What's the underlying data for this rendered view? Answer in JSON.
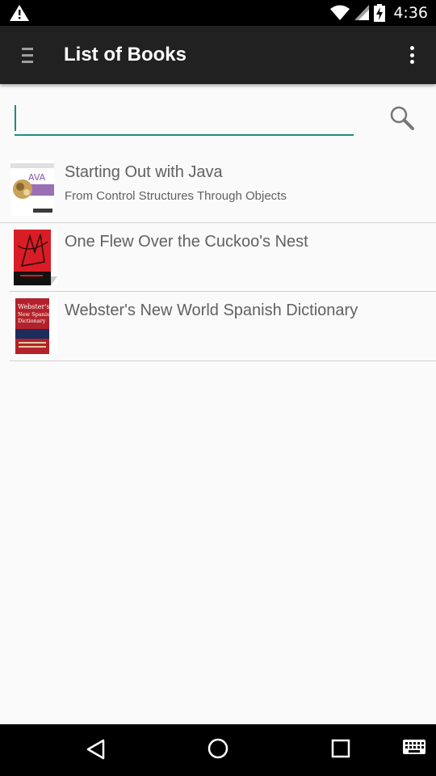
{
  "status_bar": {
    "time": "4:36",
    "icons": [
      "warning-icon",
      "wifi-icon",
      "signal-icon",
      "battery-charging-icon"
    ]
  },
  "app_bar": {
    "title": "List of Books",
    "menu_icon": "hamburger-icon",
    "overflow_icon": "more-vert-icon"
  },
  "search": {
    "value": "",
    "placeholder": "",
    "icon": "search-icon",
    "accent_color": "#1e8c82"
  },
  "books": [
    {
      "title": "Starting Out with Java",
      "subtitle": "From Control Structures Through Objects",
      "cover_text": "JAVA"
    },
    {
      "title": "One Flew Over the Cuckoo's Nest",
      "subtitle": "",
      "cover_text": ""
    },
    {
      "title": "Webster's New World Spanish Dictionary",
      "subtitle": "",
      "cover_text": "Webster's New Spanish Dictionary"
    }
  ],
  "nav_bar": {
    "icons": [
      "back-icon",
      "home-icon",
      "recents-icon",
      "keyboard-icon"
    ]
  }
}
